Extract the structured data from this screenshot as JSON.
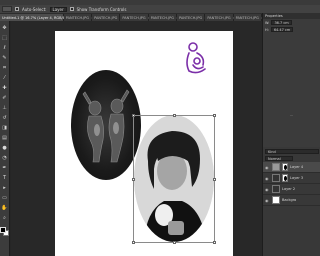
{
  "options_bar": {
    "auto_select_label": "Auto-Select:",
    "auto_select_value": "Layer",
    "show_transform_label": "Show Transform Controls"
  },
  "tabs": [
    {
      "label": "Untitled-1 @ 16.7% (Layer 4, RGB/8*)",
      "active": true
    },
    {
      "label": "PANTECH.JPG",
      "active": false
    },
    {
      "label": "PANTECH.JPG",
      "active": false
    },
    {
      "label": "PANTECH.JPG",
      "active": false
    },
    {
      "label": "PANTECH.JPG",
      "active": false
    },
    {
      "label": "PANTECH.JPG",
      "active": false
    },
    {
      "label": "PANTECH.JPG",
      "active": false
    },
    {
      "label": "PANTECH.JPG",
      "active": false
    }
  ],
  "toolbar": {
    "tools": [
      "move-tool",
      "marquee-tool",
      "lasso-tool",
      "quick-select-tool",
      "crop-tool",
      "eyedropper-tool",
      "healing-tool",
      "brush-tool",
      "stamp-tool",
      "history-brush-tool",
      "eraser-tool",
      "gradient-tool",
      "blur-tool",
      "dodge-tool",
      "pen-tool",
      "type-tool",
      "path-select-tool",
      "shape-tool",
      "hand-tool",
      "zoom-tool"
    ],
    "fg_color": "#000000",
    "bg_color": "#ffffff"
  },
  "properties": {
    "title": "Properties",
    "w_value": "36.7 cm",
    "h_value": "64.47 cm"
  },
  "layers": {
    "filter_label": "Kind",
    "blend_mode": "Normal",
    "items": [
      {
        "name": "Layer 4",
        "thumb": "g",
        "mask": true,
        "selected": true
      },
      {
        "name": "Layer 3",
        "thumb": "d",
        "mask": true,
        "selected": false
      },
      {
        "name": "Layer 2",
        "thumb": "d",
        "mask": false,
        "selected": false
      },
      {
        "name": "Backgro",
        "thumb": "w",
        "mask": false,
        "selected": false
      }
    ]
  },
  "colors": {
    "workspace": "#282828",
    "panel": "#3b3b3b",
    "logo": "#7b2fa8"
  }
}
